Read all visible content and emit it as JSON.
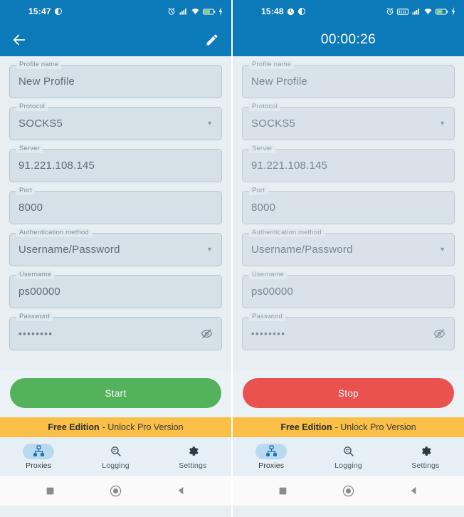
{
  "panels": [
    {
      "id": "idle",
      "status_bar": {
        "clock": "15:47",
        "icons_left": [
          "dnd-icon"
        ],
        "icons_right": [
          "alarm-icon",
          "signal-icon",
          "wifi-icon",
          "battery-icon",
          "charging-icon"
        ]
      },
      "app_bar": {
        "title": "",
        "back_icon": "back-arrow-icon",
        "action_icon": "edit-pencil-icon",
        "show_back": true,
        "show_edit": true
      },
      "action": {
        "label": "Start",
        "color": "#54b15c"
      }
    },
    {
      "id": "running",
      "status_bar": {
        "clock": "15:48",
        "icons_left": [
          "clock-icon",
          "dnd-icon"
        ],
        "icons_right": [
          "alarm-icon",
          "vpn-key-icon",
          "signal-icon",
          "wifi-icon",
          "battery-icon",
          "charging-icon"
        ]
      },
      "app_bar": {
        "title": "00:00:26",
        "back_icon": "",
        "action_icon": "",
        "show_back": false,
        "show_edit": false
      },
      "action": {
        "label": "Stop",
        "color": "#e9524f"
      }
    }
  ],
  "form": {
    "fields": [
      {
        "label": "Profile name",
        "value": "New Profile",
        "type": "text"
      },
      {
        "label": "Protocol",
        "value": "SOCKS5",
        "type": "select"
      },
      {
        "label": "Server",
        "value": "91.221.108.145",
        "type": "text"
      },
      {
        "label": "Port",
        "value": "8000",
        "type": "text"
      },
      {
        "label": "Authentication method",
        "value": "Username/Password",
        "type": "select"
      },
      {
        "label": "Username",
        "value": "ps00000",
        "type": "text"
      },
      {
        "label": "Password",
        "value": "••••••••",
        "type": "password"
      }
    ],
    "password_toggle_icon": "eye-off-icon",
    "dropdown_icon": "chevron-down-icon"
  },
  "banner": {
    "bold_text": "Free Edition",
    "rest_text": "- Unlock Pro Version",
    "background": "#f9bf47"
  },
  "bottom_nav": {
    "items": [
      {
        "label": "Proxies",
        "icon": "lan-network-icon",
        "active": true
      },
      {
        "label": "Logging",
        "icon": "search-log-icon",
        "active": false
      },
      {
        "label": "Settings",
        "icon": "gear-icon",
        "active": false
      }
    ]
  },
  "system_nav": {
    "buttons": [
      {
        "name": "recents-button",
        "icon": "square-icon"
      },
      {
        "name": "home-button",
        "icon": "circle-icon"
      },
      {
        "name": "back-button",
        "icon": "triangle-icon"
      }
    ]
  },
  "theme": {
    "header_blue": "#0c7ab8",
    "page_bg": "#e7eff3",
    "field_bg": "#d6e0e7",
    "nav_active": "#b9d9ee"
  }
}
